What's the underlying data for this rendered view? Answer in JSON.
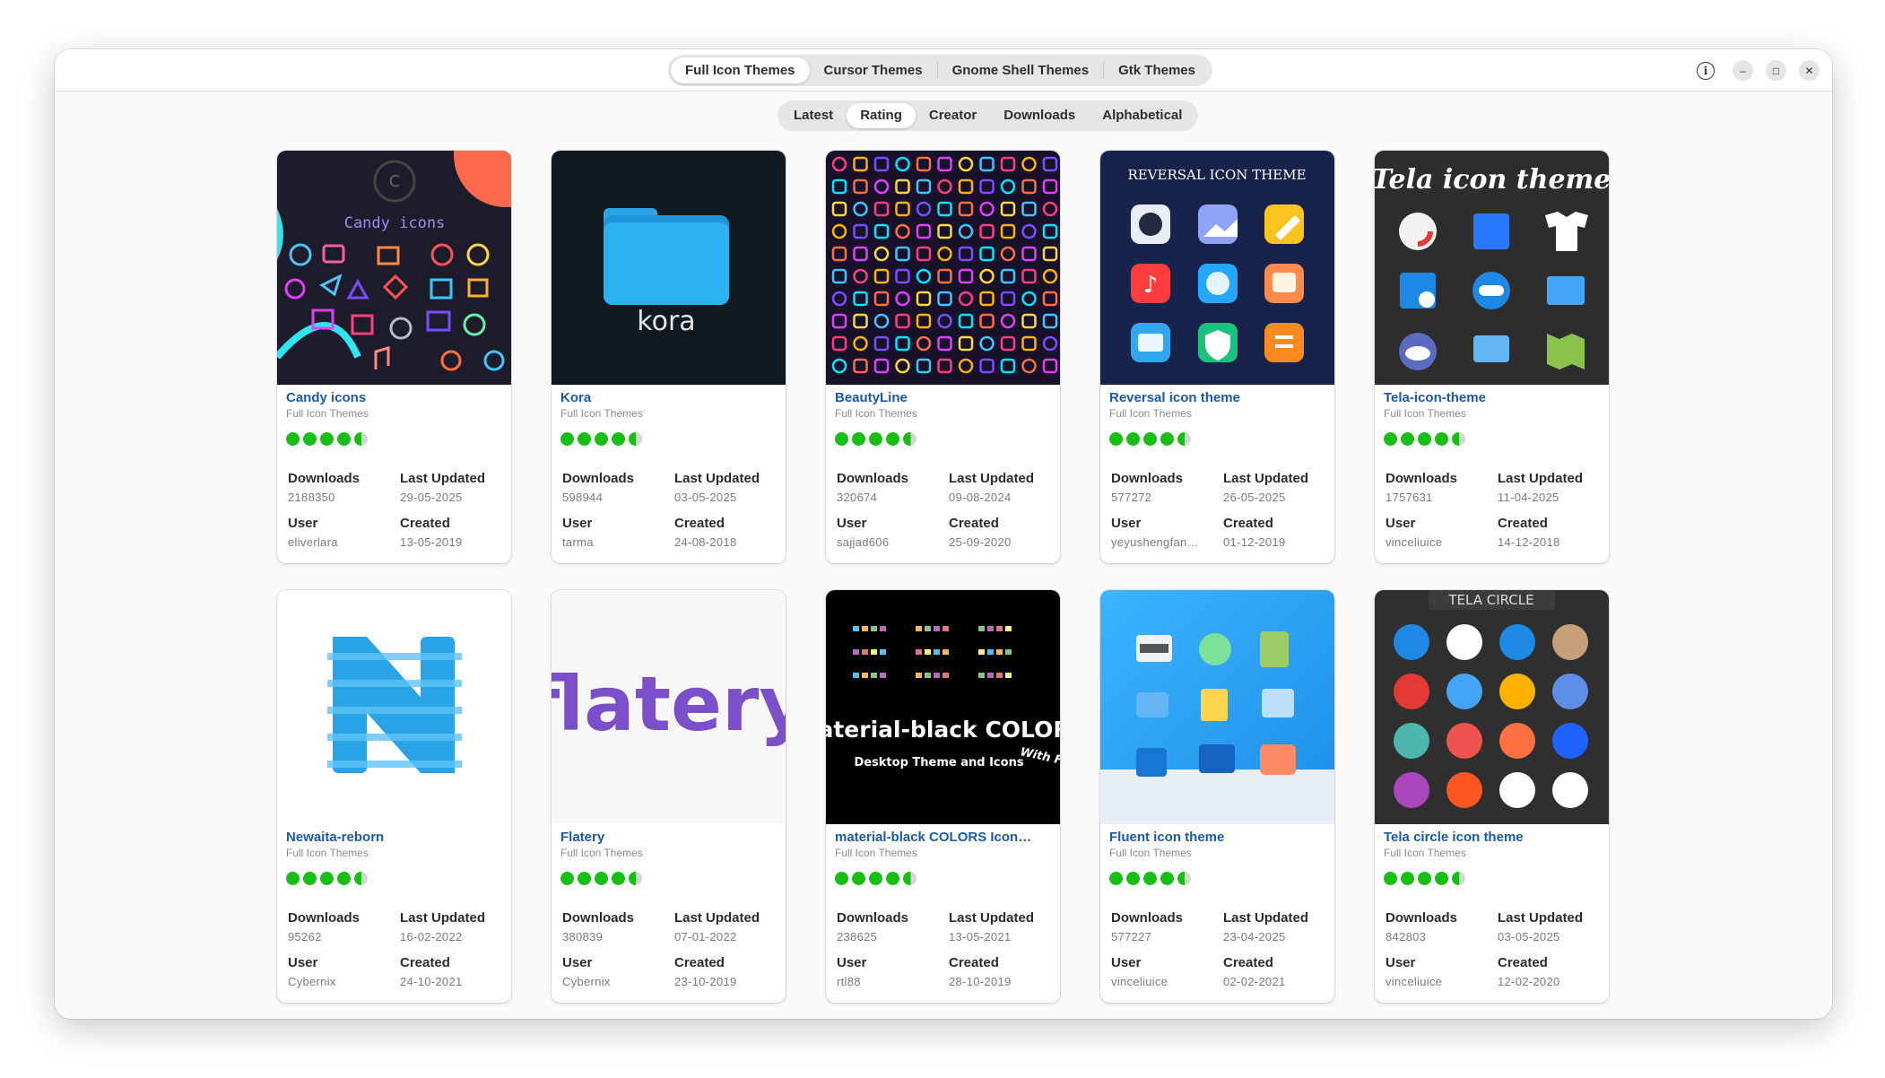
{
  "main_tabs": [
    "Full Icon Themes",
    "Cursor Themes",
    "Gnome Shell Themes",
    "Gtk Themes"
  ],
  "active_main_tab": 0,
  "sort_tabs": [
    "Latest",
    "Rating",
    "Creator",
    "Downloads",
    "Alphabetical"
  ],
  "active_sort_tab": 1,
  "window_controls": {
    "info_icon": "info-icon",
    "minimize_icon": "minimize-icon",
    "maximize_icon": "maximize-icon",
    "close_icon": "close-icon"
  },
  "labels": {
    "downloads": "Downloads",
    "last_updated": "Last Updated",
    "user": "User",
    "created": "Created"
  },
  "colors": {
    "accent": "#1c5aa6",
    "rating": "#17bf15"
  },
  "themes": [
    {
      "name": "Candy icons",
      "category": "Full Icon Themes",
      "rating_stars": 4.5,
      "downloads": "2188350",
      "last_updated": "29-05-2025",
      "user": "eliverlara",
      "created": "13-05-2019",
      "thumb_text": "Candy icons"
    },
    {
      "name": "Kora",
      "category": "Full Icon Themes",
      "rating_stars": 4.5,
      "downloads": "598944",
      "last_updated": "03-05-2025",
      "user": "tarma",
      "created": "24-08-2018",
      "thumb_text": "kora"
    },
    {
      "name": "BeautyLine",
      "category": "Full Icon Themes",
      "rating_stars": 4.5,
      "downloads": "320674",
      "last_updated": "09-08-2024",
      "user": "sajjad606",
      "created": "25-09-2020"
    },
    {
      "name": "Reversal icon theme",
      "category": "Full Icon Themes",
      "rating_stars": 4.5,
      "downloads": "577272",
      "last_updated": "26-05-2025",
      "user": "yeyushengfan…",
      "created": "01-12-2019",
      "thumb_text": "REVERSAL ICON THEME"
    },
    {
      "name": "Tela-icon-theme",
      "category": "Full Icon Themes",
      "rating_stars": 4.5,
      "downloads": "1757631",
      "last_updated": "11-04-2025",
      "user": "vinceliuice",
      "created": "14-12-2018",
      "thumb_text": "Tela icon theme"
    },
    {
      "name": "Newaita-reborn",
      "category": "Full Icon Themes",
      "rating_stars": 4.5,
      "downloads": "95262",
      "last_updated": "16-02-2022",
      "user": "Cybernix",
      "created": "24-10-2021"
    },
    {
      "name": "Flatery",
      "category": "Full Icon Themes",
      "rating_stars": 4.5,
      "downloads": "380839",
      "last_updated": "07-01-2022",
      "user": "Cybernix",
      "created": "23-10-2019",
      "thumb_text": "flatery"
    },
    {
      "name": "material-black COLORS Icon…",
      "category": "Full Icon Themes",
      "rating_stars": 4.5,
      "downloads": "238625",
      "last_updated": "13-05-2021",
      "user": "rtl88",
      "created": "28-10-2019",
      "thumb_text": "material-black COLORS",
      "thumb_subtext": "Desktop Theme and Icons",
      "thumb_subtext2": "With Fold"
    },
    {
      "name": "Fluent icon theme",
      "category": "Full Icon Themes",
      "rating_stars": 4.5,
      "downloads": "577227",
      "last_updated": "23-04-2025",
      "user": "vinceliuice",
      "created": "02-02-2021"
    },
    {
      "name": "Tela circle icon theme",
      "category": "Full Icon Themes",
      "rating_stars": 4.5,
      "downloads": "842803",
      "last_updated": "03-05-2025",
      "user": "vinceliuice",
      "created": "12-02-2020",
      "thumb_text": "TELA CIRCLE"
    }
  ]
}
